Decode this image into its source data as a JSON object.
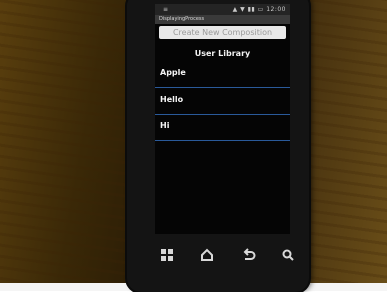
{
  "statusbar": {
    "menu_icon": "≡",
    "right_text": "▲ ▼ ▮▮ ▭ 12:00"
  },
  "app": {
    "title": "DisplayingProcess",
    "create_button_label": "Create New Composition",
    "library_title": "User Library"
  },
  "library_items": [
    {
      "label": "Apple"
    },
    {
      "label": "Hello"
    },
    {
      "label": "Hi"
    }
  ],
  "navbar": {
    "icons": [
      "grid-icon",
      "home-icon",
      "back-icon",
      "search-icon"
    ]
  }
}
